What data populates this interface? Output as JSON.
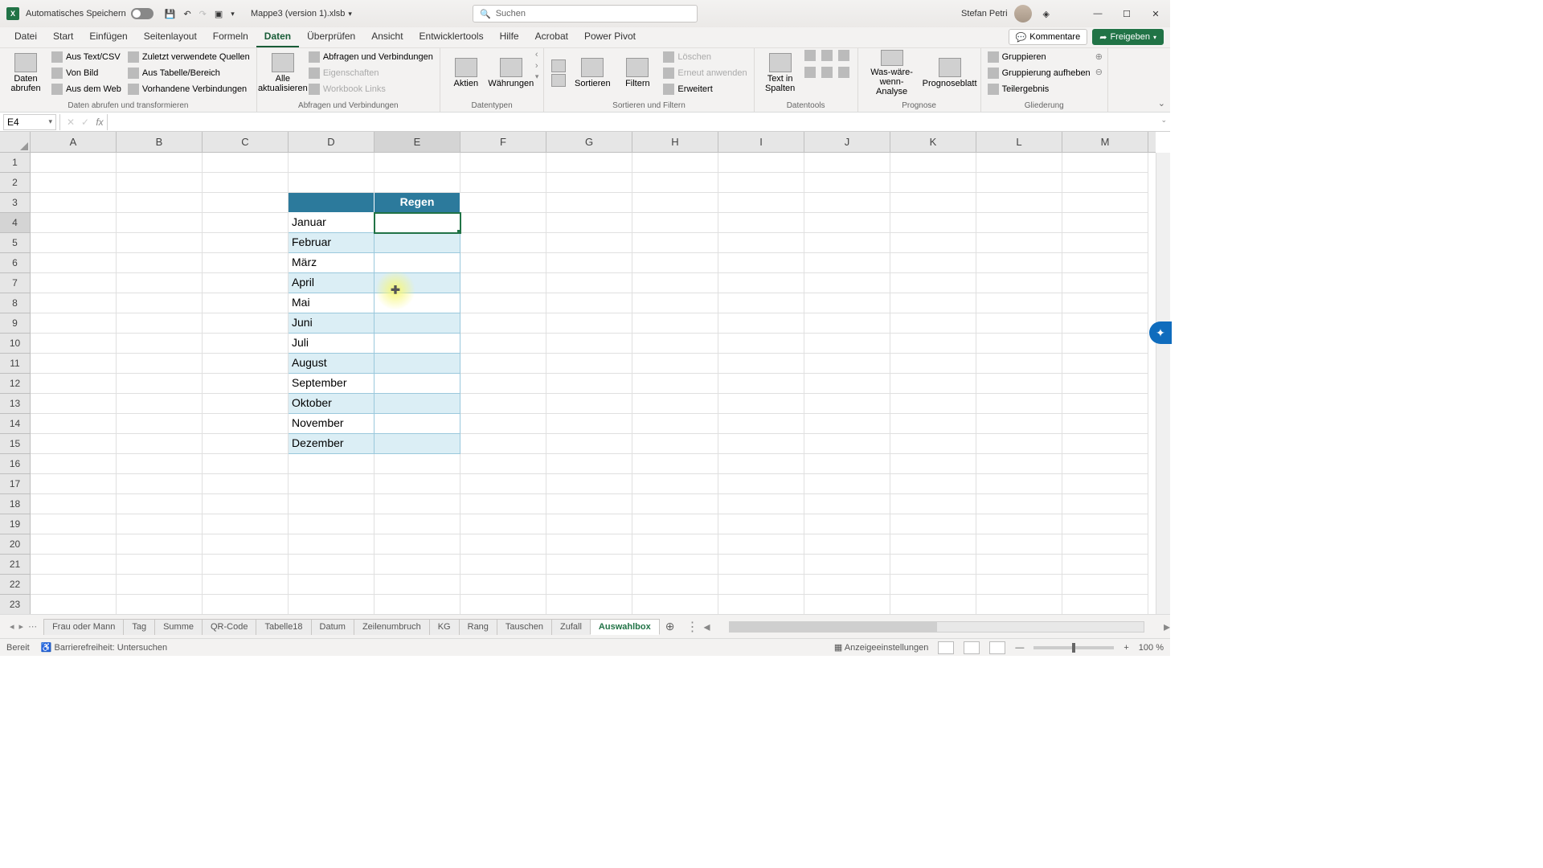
{
  "title": {
    "autosave": "Automatisches Speichern",
    "doc": "Mappe3 (version 1).xlsb",
    "search_placeholder": "Suchen",
    "user": "Stefan Petri"
  },
  "tabs": {
    "items": [
      "Datei",
      "Start",
      "Einfügen",
      "Seitenlayout",
      "Formeln",
      "Daten",
      "Überprüfen",
      "Ansicht",
      "Entwicklertools",
      "Hilfe",
      "Acrobat",
      "Power Pivot"
    ],
    "active": 5,
    "comments": "Kommentare",
    "share": "Freigeben"
  },
  "ribbon": {
    "g0": {
      "big": "Daten\nabrufen",
      "s": [
        "Aus Text/CSV",
        "Von Bild",
        "Aus dem Web",
        "Zuletzt verwendete Quellen",
        "Aus Tabelle/Bereich",
        "Vorhandene Verbindungen"
      ],
      "label": "Daten abrufen und transformieren"
    },
    "g1": {
      "big": "Alle\naktualisieren",
      "s": [
        "Abfragen und Verbindungen",
        "Eigenschaften",
        "Workbook Links"
      ],
      "label": "Abfragen und Verbindungen"
    },
    "g2": {
      "a": "Aktien",
      "b": "Währungen",
      "label": "Datentypen"
    },
    "g3": {
      "a": "Sortieren",
      "b": "Filtern",
      "s": [
        "Löschen",
        "Erneut anwenden",
        "Erweitert"
      ],
      "label": "Sortieren und Filtern"
    },
    "g4": {
      "big": "Text in\nSpalten",
      "label": "Datentools"
    },
    "g5": {
      "a": "Was-wäre-wenn-\nAnalyse",
      "b": "Prognoseblatt",
      "label": "Prognose"
    },
    "g6": {
      "s": [
        "Gruppieren",
        "Gruppierung aufheben",
        "Teilergebnis"
      ],
      "label": "Gliederung"
    }
  },
  "fbar": {
    "name": "E4",
    "fx": "fx"
  },
  "cols": [
    "A",
    "B",
    "C",
    "D",
    "E",
    "F",
    "G",
    "H",
    "I",
    "J",
    "K",
    "L",
    "M"
  ],
  "sel_col": 4,
  "rows": 24,
  "sel_row": 3,
  "table": {
    "header": "Regen",
    "months": [
      "Januar",
      "Februar",
      "März",
      "April",
      "Mai",
      "Juni",
      "Juli",
      "August",
      "September",
      "Oktober",
      "November",
      "Dezember"
    ]
  },
  "sheets": {
    "items": [
      "Frau oder Mann",
      "Tag",
      "Summe",
      "QR-Code",
      "Tabelle18",
      "Datum",
      "Zeilenumbruch",
      "KG",
      "Rang",
      "Tauschen",
      "Zufall",
      "Auswahlbox"
    ],
    "active": 11
  },
  "status": {
    "ready": "Bereit",
    "access": "Barrierefreiheit: Untersuchen",
    "disp": "Anzeigeeinstellungen",
    "zoom": "100 %"
  }
}
